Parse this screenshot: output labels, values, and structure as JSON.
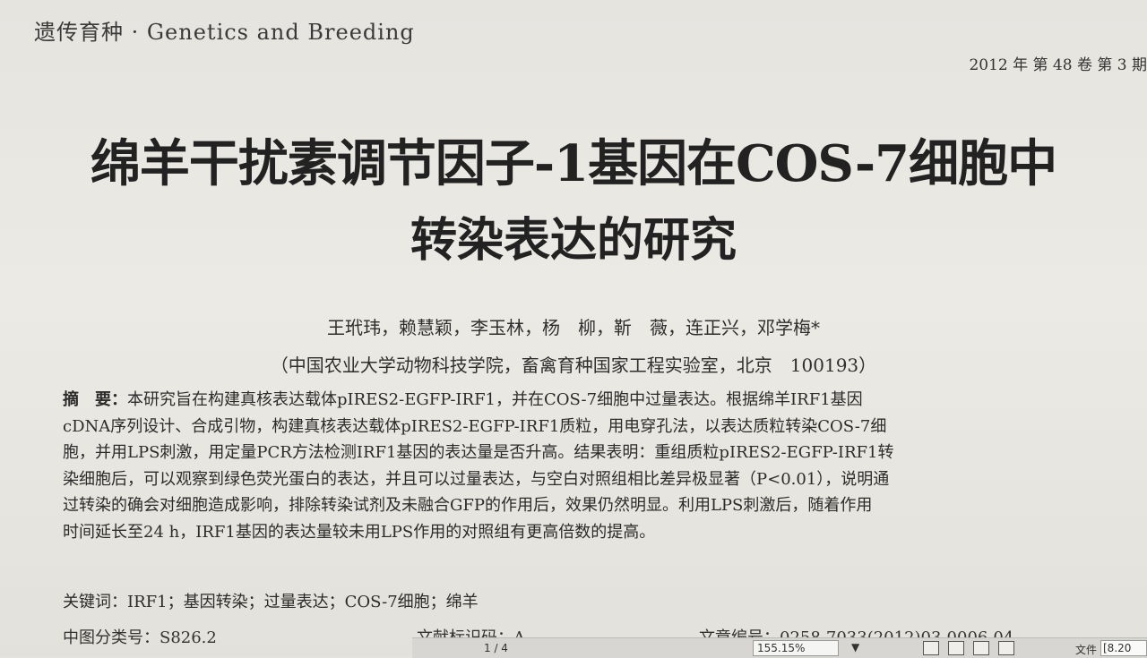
{
  "header": {
    "journal": "遗传育种 · Genetics and Breeding",
    "issue": "2012 年 第 48 卷 第 3 期"
  },
  "title": {
    "line1": "绵羊干扰素调节因子-1基因在COS-7细胞中",
    "line2": "转染表达的研究"
  },
  "authors": "王玳玮，赖慧颖，李玉林，杨　柳，靳　薇，连正兴，邓学梅*",
  "affiliation": "（中国农业大学动物科技学院，畜禽育种国家工程实验室，北京　100193）",
  "abstract": {
    "label": "摘　要：",
    "lines": [
      "本研究旨在构建真核表达载体pIRES2-EGFP-IRF1，并在COS-7细胞中过量表达。根据绵羊IRF1基因",
      "cDNA序列设计、合成引物，构建真核表达载体pIRES2-EGFP-IRF1质粒，用电穿孔法，以表达质粒转染COS-7细",
      "胞，并用LPS刺激，用定量PCR方法检测IRF1基因的表达量是否升高。结果表明：重组质粒pIRES2-EGFP-IRF1转",
      "染细胞后，可以观察到绿色荧光蛋白的表达，并且可以过量表达，与空白对照组相比差异极显著（P<0.01），说明通",
      "过转染的确会对细胞造成影响，排除转染试剂及未融合GFP的作用后，效果仍然明显。利用LPS刺激后，随着作用",
      "时间延长至24 h，IRF1基因的表达量较未用LPS作用的对照组有更高倍数的提高。"
    ]
  },
  "keywords": "关键词：IRF1；基因转染；过量表达；COS-7细胞；绵羊",
  "meta": {
    "clc": "中图分类号：S826.2",
    "doc_code": "文献标识码：A",
    "article_no": "文章编号：0258-7033(2012)03-0006-04"
  },
  "statusbar": {
    "page": "1 / 4",
    "zoom": "155.15%",
    "zoom_arrow": "▼",
    "file_label": "文件",
    "file_value": "[8.20"
  }
}
